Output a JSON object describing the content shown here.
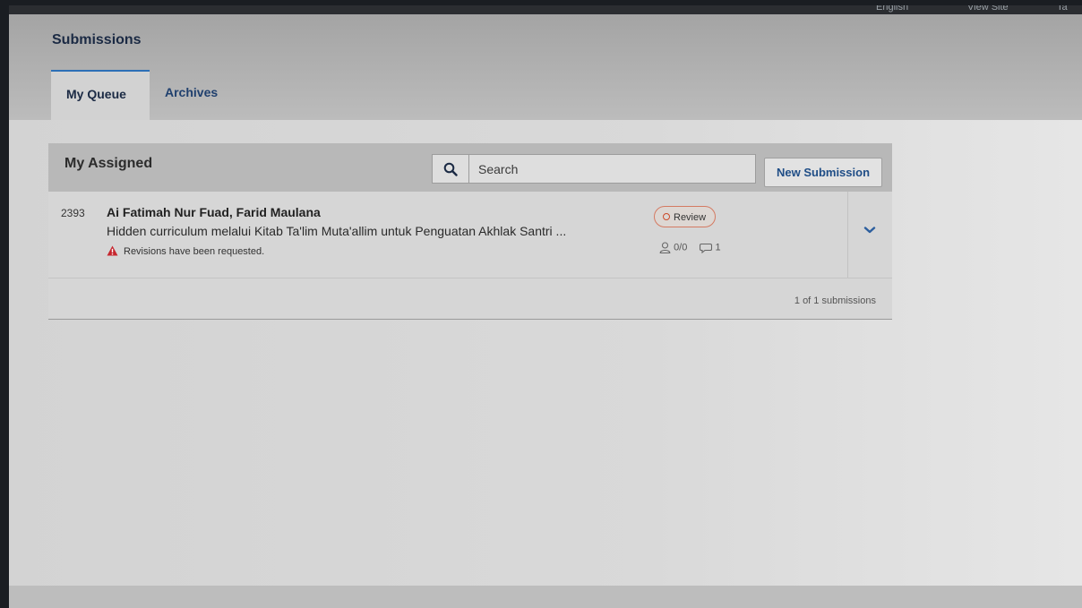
{
  "topbar": {
    "language": "English",
    "view_site": "View Site",
    "user": "Ta"
  },
  "page": {
    "title": "Submissions"
  },
  "tabs": [
    {
      "label": "My Queue",
      "active": true
    },
    {
      "label": "Archives",
      "active": false
    }
  ],
  "panel": {
    "title": "My Assigned",
    "search_placeholder": "Search",
    "new_submission_label": "New Submission"
  },
  "submissions": [
    {
      "id": "2393",
      "authors": "Ai Fatimah Nur Fuad, Farid Maulana",
      "title": "Hidden curriculum melalui Kitab Ta'lim Muta'allim untuk Penguatan Akhlak Santri ...",
      "notice": "Revisions have been requested.",
      "stage": "Review",
      "reviews": "0/0",
      "discussions": "1"
    }
  ],
  "pagination": {
    "summary": "1 of 1 submissions"
  },
  "colors": {
    "accent": "#2c6fb6",
    "link": "#1f4d86",
    "stage_review": "#cc4a2a",
    "warning": "#c6262e"
  },
  "icons": [
    "search-icon",
    "warning-icon",
    "user-icon",
    "comment-icon",
    "chevron-down-icon"
  ]
}
